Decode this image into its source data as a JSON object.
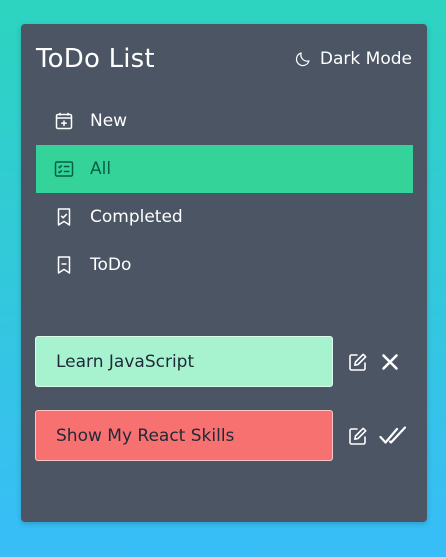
{
  "app": {
    "title": "ToDo List",
    "dark_mode_label": "Dark Mode",
    "dark_mode_icon": "moon-icon"
  },
  "nav": {
    "items": [
      {
        "label": "New",
        "icon": "calendar-plus-icon",
        "active": false
      },
      {
        "label": "All",
        "icon": "list-check-icon",
        "active": true
      },
      {
        "label": "Completed",
        "icon": "bookmark-check-icon",
        "active": false
      },
      {
        "label": "ToDo",
        "icon": "bookmark-dash-icon",
        "active": false
      }
    ]
  },
  "todos": [
    {
      "text": "Learn JavaScript",
      "status": "completed",
      "actions": [
        "edit-icon",
        "delete-x-icon"
      ]
    },
    {
      "text": "Show My React Skills",
      "status": "pending",
      "actions": [
        "edit-icon",
        "mark-done-check-icon"
      ]
    }
  ],
  "colors": {
    "card_bg": "#4b5563",
    "active_nav_bg": "#34d399",
    "completed_todo_bg": "#a7f3d0",
    "pending_todo_bg": "#f87171",
    "background_gradient_top": "#2dd4bf",
    "background_gradient_bottom": "#38bdf8"
  }
}
